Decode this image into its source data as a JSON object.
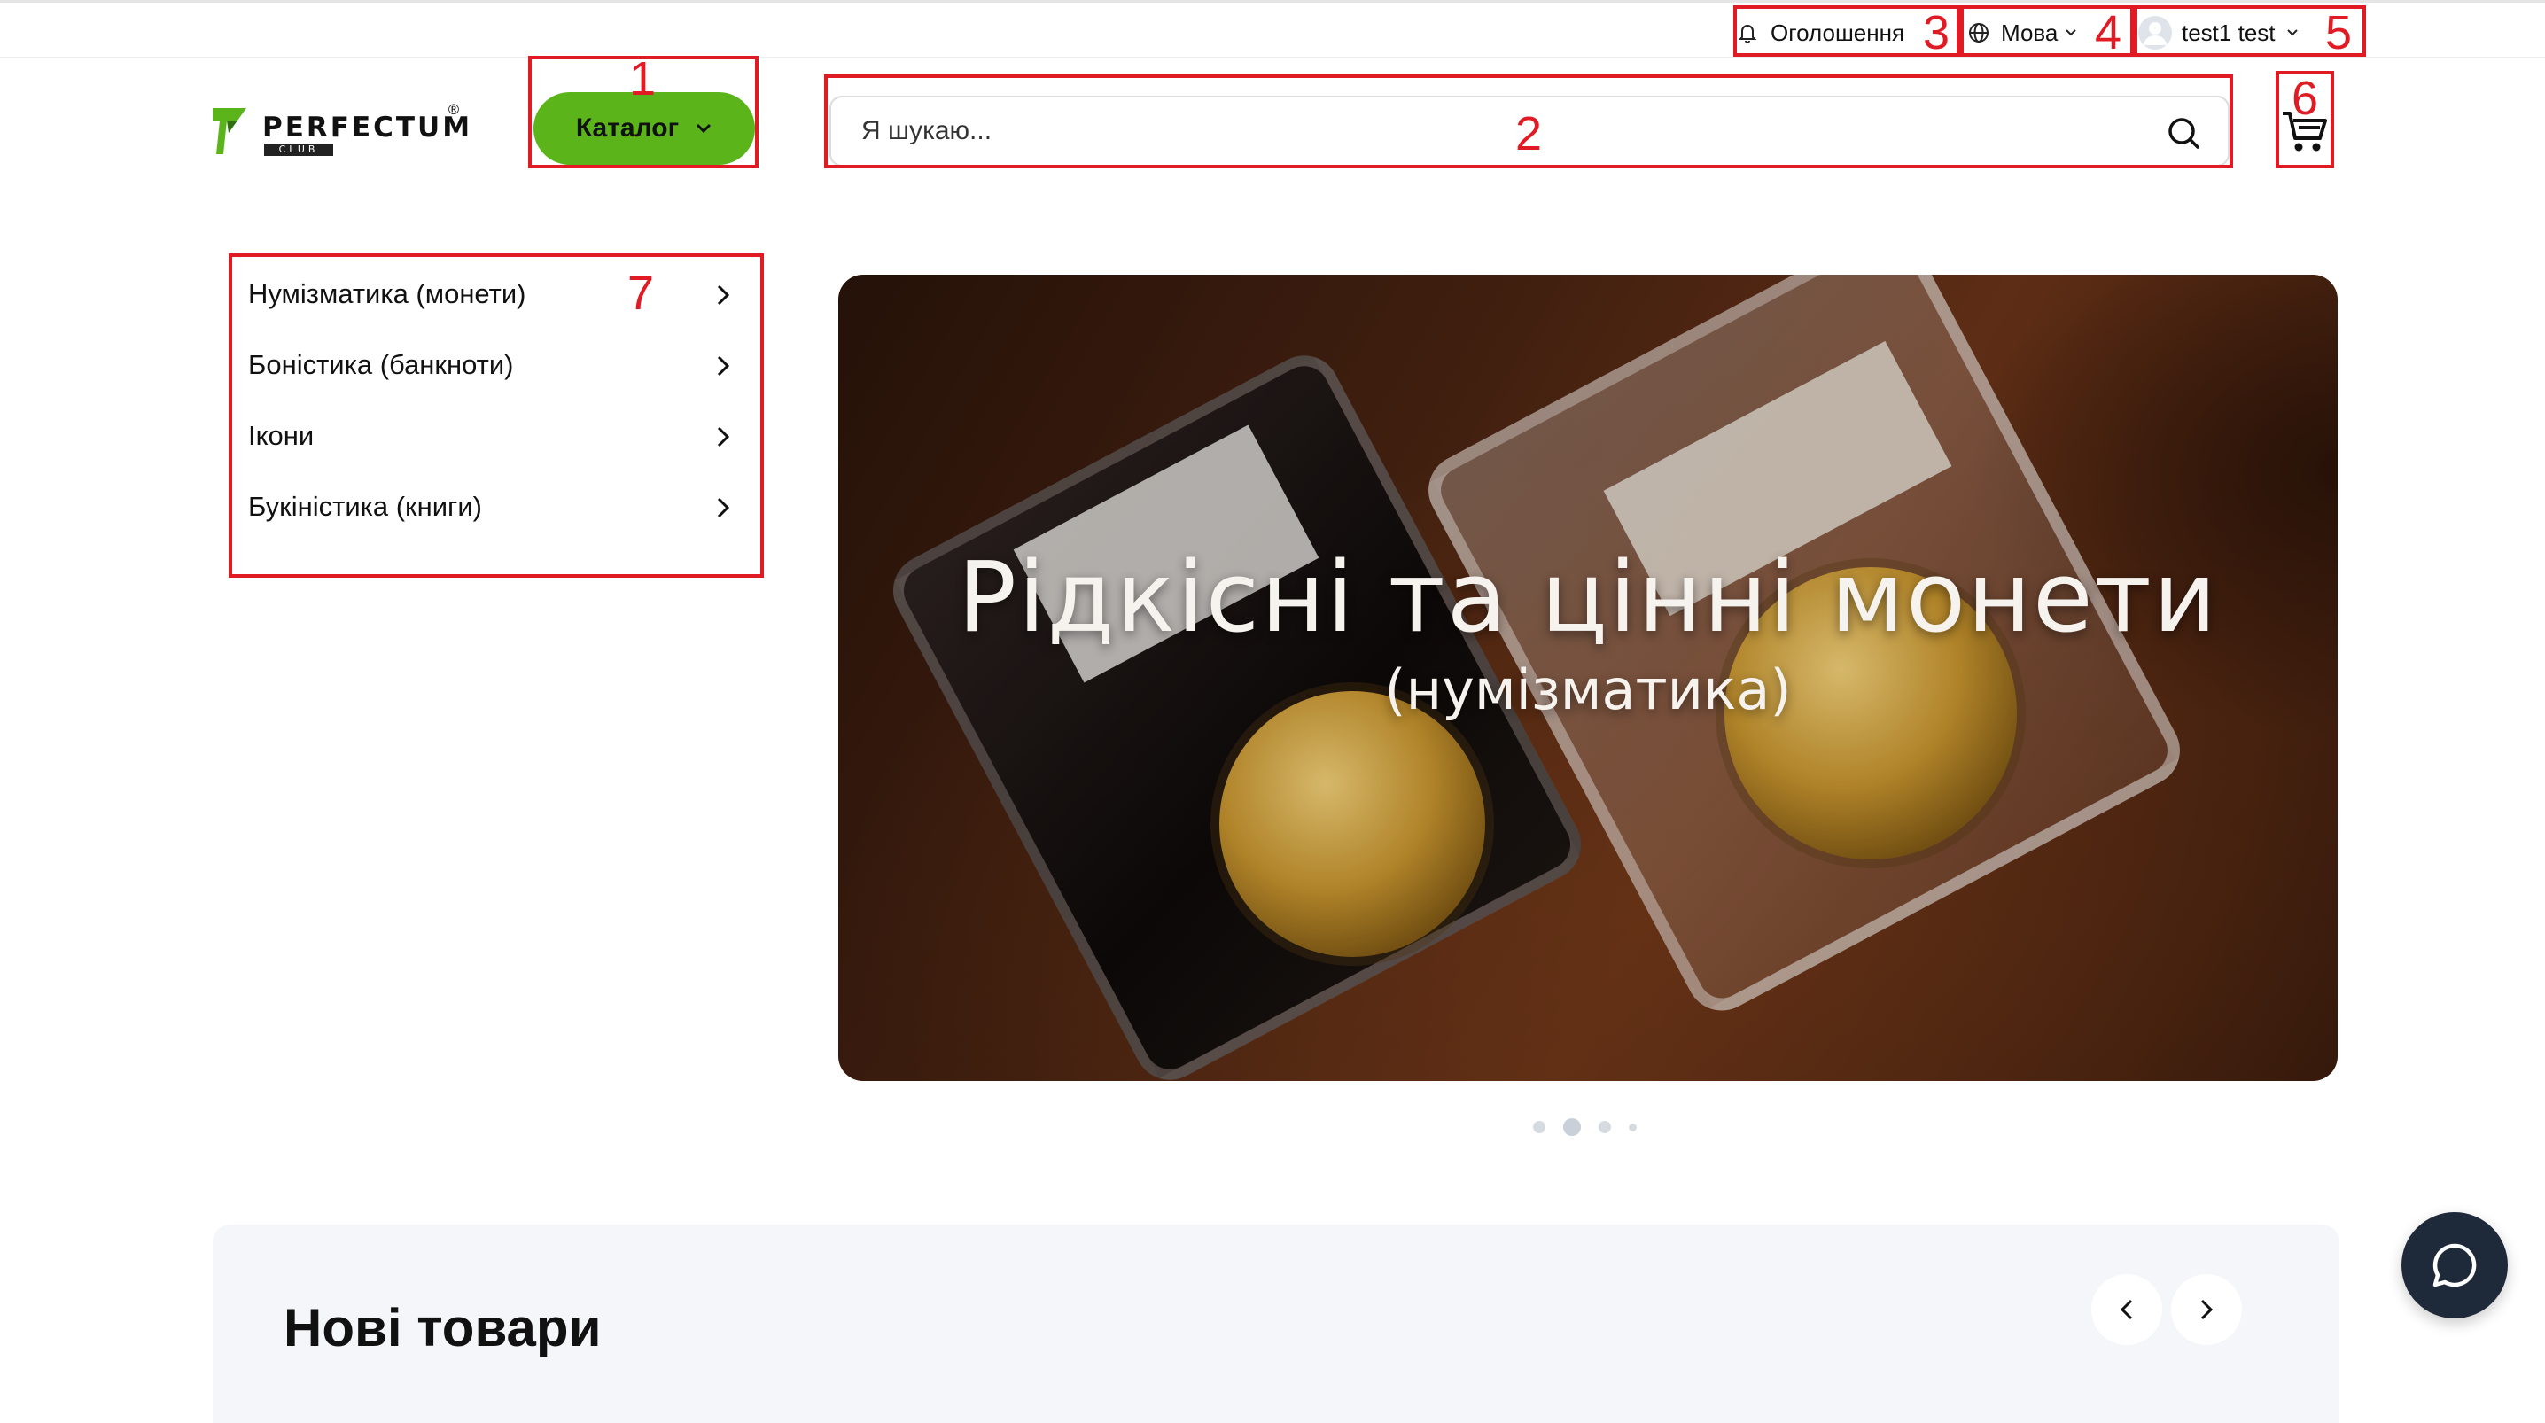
{
  "topbar": {
    "announcements_label": "Оголошення",
    "language_label": "Мова",
    "user_label": "test1 test"
  },
  "header": {
    "logo_text": "PERFECTUM",
    "logo_sub": "CLUB",
    "logo_reg": "®",
    "catalog_label": "Каталог",
    "search_placeholder": "Я шукаю..."
  },
  "categories": [
    {
      "label": "Нумізматика (монети)"
    },
    {
      "label": "Боністика (банкноти)"
    },
    {
      "label": "Ікони"
    },
    {
      "label": "Букіністика (книги)"
    }
  ],
  "banner": {
    "title": "Рідкісні та цінні монети",
    "subtitle": "(нумізматика)",
    "slide_count": 4,
    "active_slide": 2
  },
  "new_products": {
    "title": "Нові товари"
  },
  "annotations": [
    "1",
    "2",
    "3",
    "4",
    "5",
    "6",
    "7"
  ],
  "colors": {
    "accent_green": "#5bb51a",
    "annotation_red": "#e01b24",
    "chat_bg": "#1e2a3a",
    "section_bg": "#f4f6fa"
  },
  "icons": [
    "bell-icon",
    "globe-icon",
    "chevron-down-icon",
    "avatar",
    "search-icon",
    "cart-icon",
    "chevron-right-icon",
    "chevron-left-icon",
    "chat-icon"
  ]
}
